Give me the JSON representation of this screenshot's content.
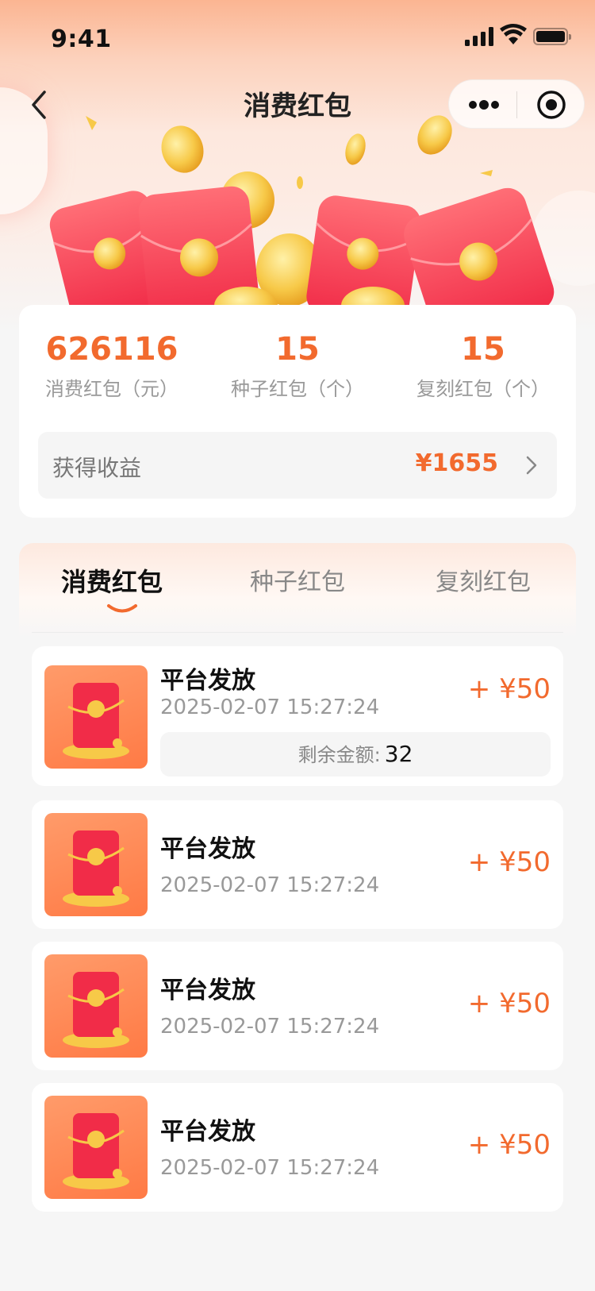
{
  "status_bar": {
    "time": "9:41"
  },
  "nav": {
    "title": "消费红包"
  },
  "summary": {
    "stats": [
      {
        "value": "626116",
        "label": "消费红包（元）"
      },
      {
        "value": "15",
        "label": "种子红包（个）"
      },
      {
        "value": "15",
        "label": "复刻红包（个）"
      }
    ],
    "earnings": {
      "label": "获得收益",
      "amount": "¥1655"
    }
  },
  "tabs": [
    {
      "label": "消费红包",
      "active": true
    },
    {
      "label": "种子红包",
      "active": false
    },
    {
      "label": "复刻红包",
      "active": false
    }
  ],
  "records": [
    {
      "title": "平台发放",
      "time": "2025-02-07 15:27:24",
      "amount": "+ ¥50",
      "remaining_label": "剩余金额:",
      "remaining_value": "32"
    },
    {
      "title": "平台发放",
      "time": "2025-02-07 15:27:24",
      "amount": "+ ¥50"
    },
    {
      "title": "平台发放",
      "time": "2025-02-07 15:27:24",
      "amount": "+ ¥50"
    },
    {
      "title": "平台发放",
      "time": "2025-02-07 15:27:24",
      "amount": "+ ¥50"
    }
  ],
  "colors": {
    "accent": "#f26a2e",
    "envelope": "#f2344a",
    "coin": "#f7c948"
  }
}
